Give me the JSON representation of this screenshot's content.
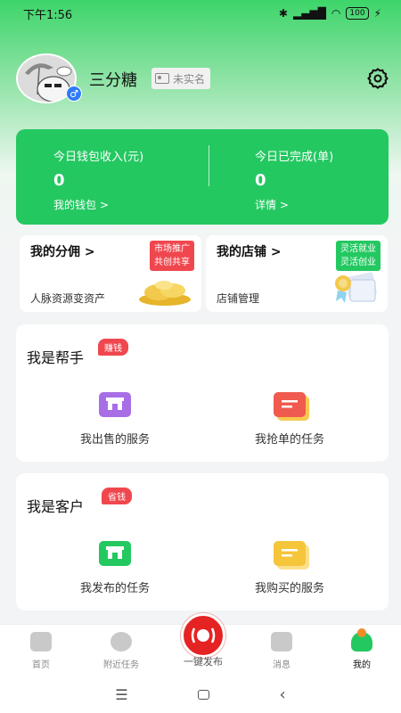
{
  "status_bar": {
    "time": "下午1:56",
    "battery": "100"
  },
  "profile": {
    "name": "三分糖",
    "verify_label": "未实名",
    "gender_symbol": "♂"
  },
  "wallet": {
    "income_title": "今日钱包收入(元)",
    "income_value": "0",
    "income_link": "我的钱包 >",
    "done_title": "今日已完成(单)",
    "done_value": "0",
    "done_link": "详情 >"
  },
  "promo_cards": [
    {
      "title": "我的分佣 >",
      "subtitle": "人脉资源变资产",
      "tag_line1": "市场推广",
      "tag_line2": "共创共享",
      "tag_color": "#f0474f"
    },
    {
      "title": "我的店铺 >",
      "subtitle": "店铺管理",
      "tag_line1": "灵活就业",
      "tag_line2": "灵活创业",
      "tag_color": "#24c861"
    }
  ],
  "helper_section": {
    "title": "我是帮手",
    "badge": "赚钱",
    "items": [
      {
        "label": "我出售的服务",
        "icon": "store-icon",
        "color": "#a86ee6"
      },
      {
        "label": "我抢单的任务",
        "icon": "task-list-icon",
        "color": "#f05a4f"
      }
    ]
  },
  "customer_section": {
    "title": "我是客户",
    "badge": "省钱",
    "items": [
      {
        "label": "我发布的任务",
        "icon": "store-icon",
        "color": "#24c861"
      },
      {
        "label": "我购买的服务",
        "icon": "task-list-icon",
        "color": "#f5c53a"
      }
    ]
  },
  "bottom_nav": {
    "items": [
      {
        "label": "首页",
        "icon": "home-shield-icon"
      },
      {
        "label": "附近任务",
        "icon": "nearby-icon"
      },
      {
        "label": "消息",
        "icon": "message-icon"
      },
      {
        "label": "我的",
        "icon": "profile-icon"
      }
    ],
    "publish_label": "一键发布"
  }
}
